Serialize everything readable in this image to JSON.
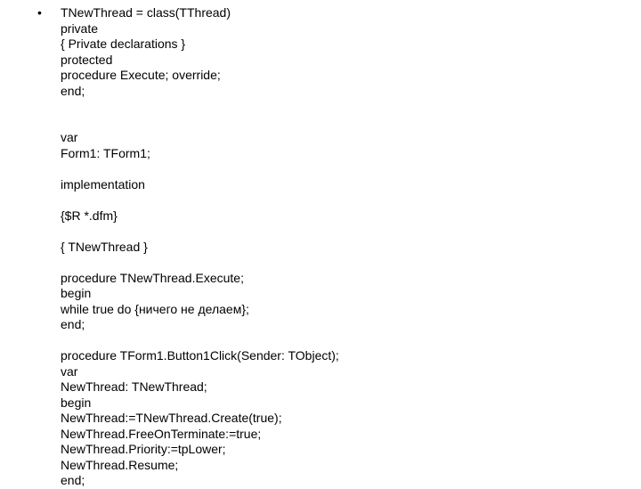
{
  "bullet": "•",
  "code": "TNewThread = class(TThread)\nprivate\n{ Private declarations }\nprotected\nprocedure Execute; override;\nend;\n\n\nvar\nForm1: TForm1;\n\nimplementation\n\n{$R *.dfm}\n\n{ TNewThread }\n\nprocedure TNewThread.Execute;\nbegin\nwhile true do {ничего не делаем};\nend;\n\nprocedure TForm1.Button1Click(Sender: TObject);\nvar\nNewThread: TNewThread;\nbegin\nNewThread:=TNewThread.Create(true);\nNewThread.FreeOnTerminate:=true;\nNewThread.Priority:=tpLower;\nNewThread.Resume;\nend;"
}
